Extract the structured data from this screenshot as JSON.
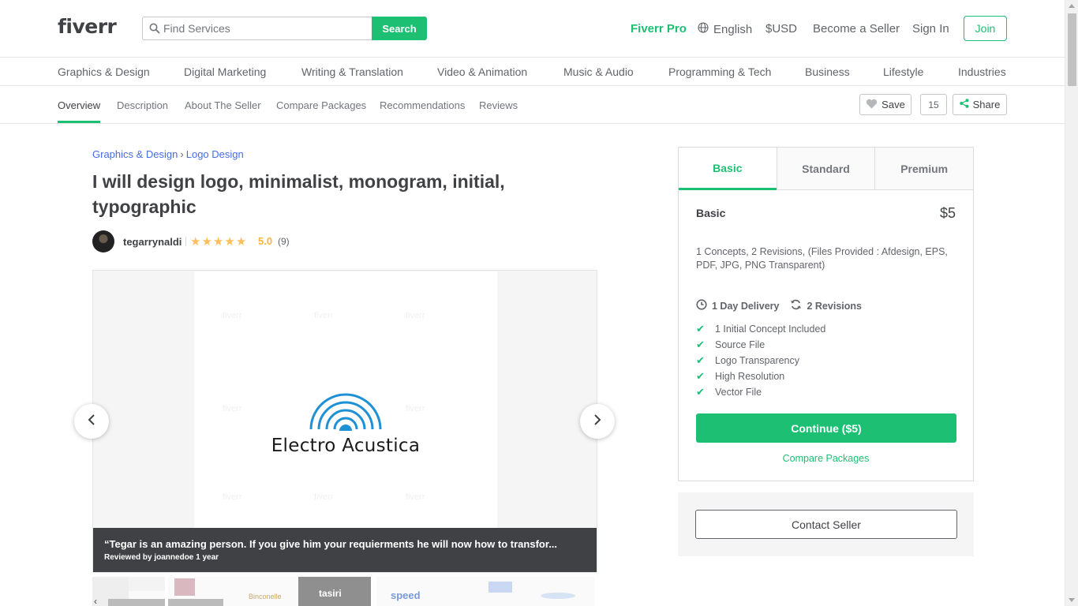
{
  "header": {
    "logo": "fiverr",
    "search_placeholder": "Find Services",
    "search_button": "Search",
    "fiverr_pro": "Fiverr Pro",
    "language": "English",
    "currency": "$USD",
    "become_seller": "Become a Seller",
    "sign_in": "Sign In",
    "join": "Join",
    "accent_color": "#1dbf73"
  },
  "categories": [
    "Graphics & Design",
    "Digital Marketing",
    "Writing & Translation",
    "Video & Animation",
    "Music & Audio",
    "Programming & Tech",
    "Business",
    "Lifestyle",
    "Industries"
  ],
  "subnav": {
    "tabs": [
      "Overview",
      "Description",
      "About The Seller",
      "Compare Packages",
      "Recommendations",
      "Reviews"
    ],
    "save": "Save",
    "save_count": "15",
    "share": "Share"
  },
  "gig": {
    "breadcrumb": [
      "Graphics & Design",
      "Logo Design"
    ],
    "title": "I will design logo, minimalist, monogram, initial, typographic",
    "seller": "tegarrynaldi",
    "rating": "5.0",
    "rating_count": "(9)",
    "stars": 5
  },
  "gallery": {
    "brand_text": "Electro Acustica",
    "review_text": "“Tegar is an amazing person. If you give him your requierments he will now how to transfor...",
    "review_meta": "Reviewed by joannedoe 1 year",
    "thumb_labels": [
      "Binconelle",
      "tasiri",
      "speed"
    ]
  },
  "package": {
    "tabs": [
      "Basic",
      "Standard",
      "Premium"
    ],
    "name": "Basic",
    "price": "$5",
    "description": "1 Concepts, 2 Revisions, (Files Provided : Afdesign, EPS, PDF, JPG, PNG Transparent)",
    "delivery": "1 Day Delivery",
    "revisions": "2 Revisions",
    "features": [
      "1 Initial Concept Included",
      "Source File",
      "Logo Transparency",
      "High Resolution",
      "Vector File"
    ],
    "continue": "Continue ($5)",
    "compare": "Compare Packages",
    "contact": "Contact Seller"
  }
}
